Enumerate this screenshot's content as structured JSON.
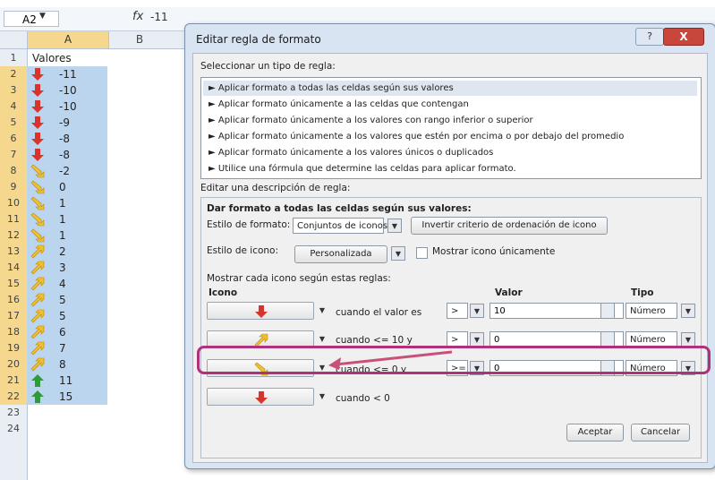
{
  "excel": {
    "name_box": "A2",
    "formula_fx": "fx",
    "formula_value": "-11",
    "col_a": "A",
    "col_b": "B",
    "header_row_label": "1",
    "header_cell": "Valores",
    "rows": [
      {
        "row": "2",
        "value": "-11",
        "icon": "red-down-arrow"
      },
      {
        "row": "3",
        "value": "-10",
        "icon": "red-down-arrow"
      },
      {
        "row": "4",
        "value": "-10",
        "icon": "red-down-arrow"
      },
      {
        "row": "5",
        "value": "-9",
        "icon": "red-down-arrow"
      },
      {
        "row": "6",
        "value": "-8",
        "icon": "red-down-arrow"
      },
      {
        "row": "7",
        "value": "-8",
        "icon": "red-down-arrow"
      },
      {
        "row": "8",
        "value": "-2",
        "icon": "yellow-down-right-arrow"
      },
      {
        "row": "9",
        "value": "0",
        "icon": "yellow-down-right-arrow"
      },
      {
        "row": "10",
        "value": "1",
        "icon": "yellow-down-right-arrow"
      },
      {
        "row": "11",
        "value": "1",
        "icon": "yellow-down-right-arrow"
      },
      {
        "row": "12",
        "value": "1",
        "icon": "yellow-down-right-arrow"
      },
      {
        "row": "13",
        "value": "2",
        "icon": "yellow-up-right-arrow"
      },
      {
        "row": "14",
        "value": "3",
        "icon": "yellow-up-right-arrow"
      },
      {
        "row": "15",
        "value": "4",
        "icon": "yellow-up-right-arrow"
      },
      {
        "row": "16",
        "value": "5",
        "icon": "yellow-up-right-arrow"
      },
      {
        "row": "17",
        "value": "5",
        "icon": "yellow-up-right-arrow"
      },
      {
        "row": "18",
        "value": "6",
        "icon": "yellow-up-right-arrow"
      },
      {
        "row": "19",
        "value": "7",
        "icon": "yellow-up-right-arrow"
      },
      {
        "row": "20",
        "value": "8",
        "icon": "yellow-up-right-arrow"
      },
      {
        "row": "21",
        "value": "11",
        "icon": "green-up-arrow"
      },
      {
        "row": "22",
        "value": "15",
        "icon": "green-up-arrow"
      }
    ],
    "trailing_rows": [
      "23",
      "24"
    ]
  },
  "dialog": {
    "title": "Editar regla de formato",
    "help_label": "?",
    "close_label": "X",
    "select_type_label": "Seleccionar un tipo de regla:",
    "rule_types": [
      "► Aplicar formato a todas las celdas según sus valores",
      "► Aplicar formato únicamente a las celdas que contengan",
      "► Aplicar formato únicamente a los valores con rango inferior o superior",
      "► Aplicar formato únicamente a los valores que estén por encima o por debajo del promedio",
      "► Aplicar formato únicamente a los valores únicos o duplicados",
      "► Utilice una fórmula que determine las celdas para aplicar formato."
    ],
    "edit_desc_label": "Editar una descripción de regla:",
    "format_all_label": "Dar formato a todas las celdas según sus valores:",
    "format_style_label": "Estilo de formato:",
    "format_style_value": "Conjuntos de iconos",
    "reverse_button": "Invertir criterio de ordenación de icono",
    "icon_style_label": "Estilo de icono:",
    "icon_style_value": "Personalizada",
    "show_icon_only": "Mostrar icono únicamente",
    "show_each_icon": "Mostrar cada icono según estas reglas:",
    "col_icon": "Icono",
    "col_value": "Valor",
    "col_type": "Tipo",
    "rules": [
      {
        "icon": "red-down-arrow",
        "condition": "cuando el valor es",
        "op": ">",
        "value": "10",
        "type": "Número"
      },
      {
        "icon": "yellow-up-right-arrow",
        "condition": "cuando <= 10 y",
        "op": ">",
        "value": "0",
        "type": "Número"
      },
      {
        "icon": "yellow-down-right-arrow",
        "condition": "cuando <= 0 y",
        "op": ">=",
        "value": "0",
        "type": "Número"
      },
      {
        "icon": "red-down-arrow",
        "condition": "cuando < 0"
      }
    ],
    "ok_button": "Aceptar",
    "cancel_button": "Cancelar"
  },
  "colors": {
    "selection": "#bcd5ef",
    "header_highlight": "#f5d78e",
    "annotation": "#b0307a"
  }
}
